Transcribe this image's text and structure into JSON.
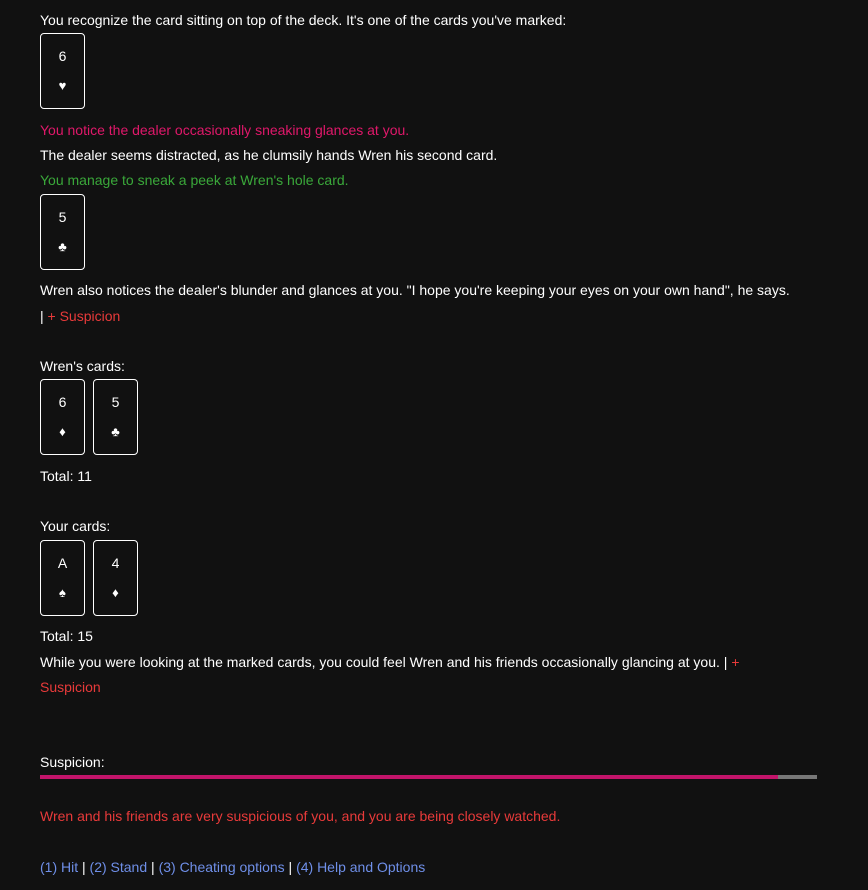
{
  "log": {
    "marked_intro": "You recognize the card sitting on top of the deck. It's one of the cards you've marked:",
    "marked_card": {
      "rank": "6",
      "suit": "♥"
    },
    "dealer_glances": "You notice the dealer occasionally sneaking glances at you.",
    "dealer_distracted": "The dealer seems distracted, as he clumsily hands Wren his second card.",
    "peek": "You manage to sneak a peek at Wren's hole card.",
    "hole_card": {
      "rank": "5",
      "suit": "♣"
    },
    "wren_notices": "Wren also notices the dealer's blunder and glances at you. \"I hope you're keeping your eyes on your own hand\", he says.",
    "separator": "|",
    "suspicion_plus": "+ Suspicion",
    "marked_watch_text": "While you were looking at the marked cards, you could feel Wren and his friends occasionally glancing at you.",
    "suspicion_plus_1": "+",
    "suspicion_plus_2": "Suspicion"
  },
  "wren": {
    "label": "Wren's cards:",
    "cards": [
      {
        "rank": "6",
        "suit": "♦"
      },
      {
        "rank": "5",
        "suit": "♣"
      }
    ],
    "total": "Total: 11"
  },
  "player": {
    "label": "Your cards:",
    "cards": [
      {
        "rank": "A",
        "suit": "♠"
      },
      {
        "rank": "4",
        "suit": "♦"
      }
    ],
    "total": "Total: 15"
  },
  "suspicion": {
    "label": "Suspicion:",
    "level": 0.95,
    "fill_color": "#c2146a",
    "track_color": "#777777",
    "message": "Wren and his friends are very suspicious of you, and you are being closely watched."
  },
  "actions": {
    "hit": "(1) Hit",
    "stand": "(2) Stand",
    "cheat": "(3) Cheating options",
    "help": "(4) Help and Options",
    "sep": "|"
  }
}
